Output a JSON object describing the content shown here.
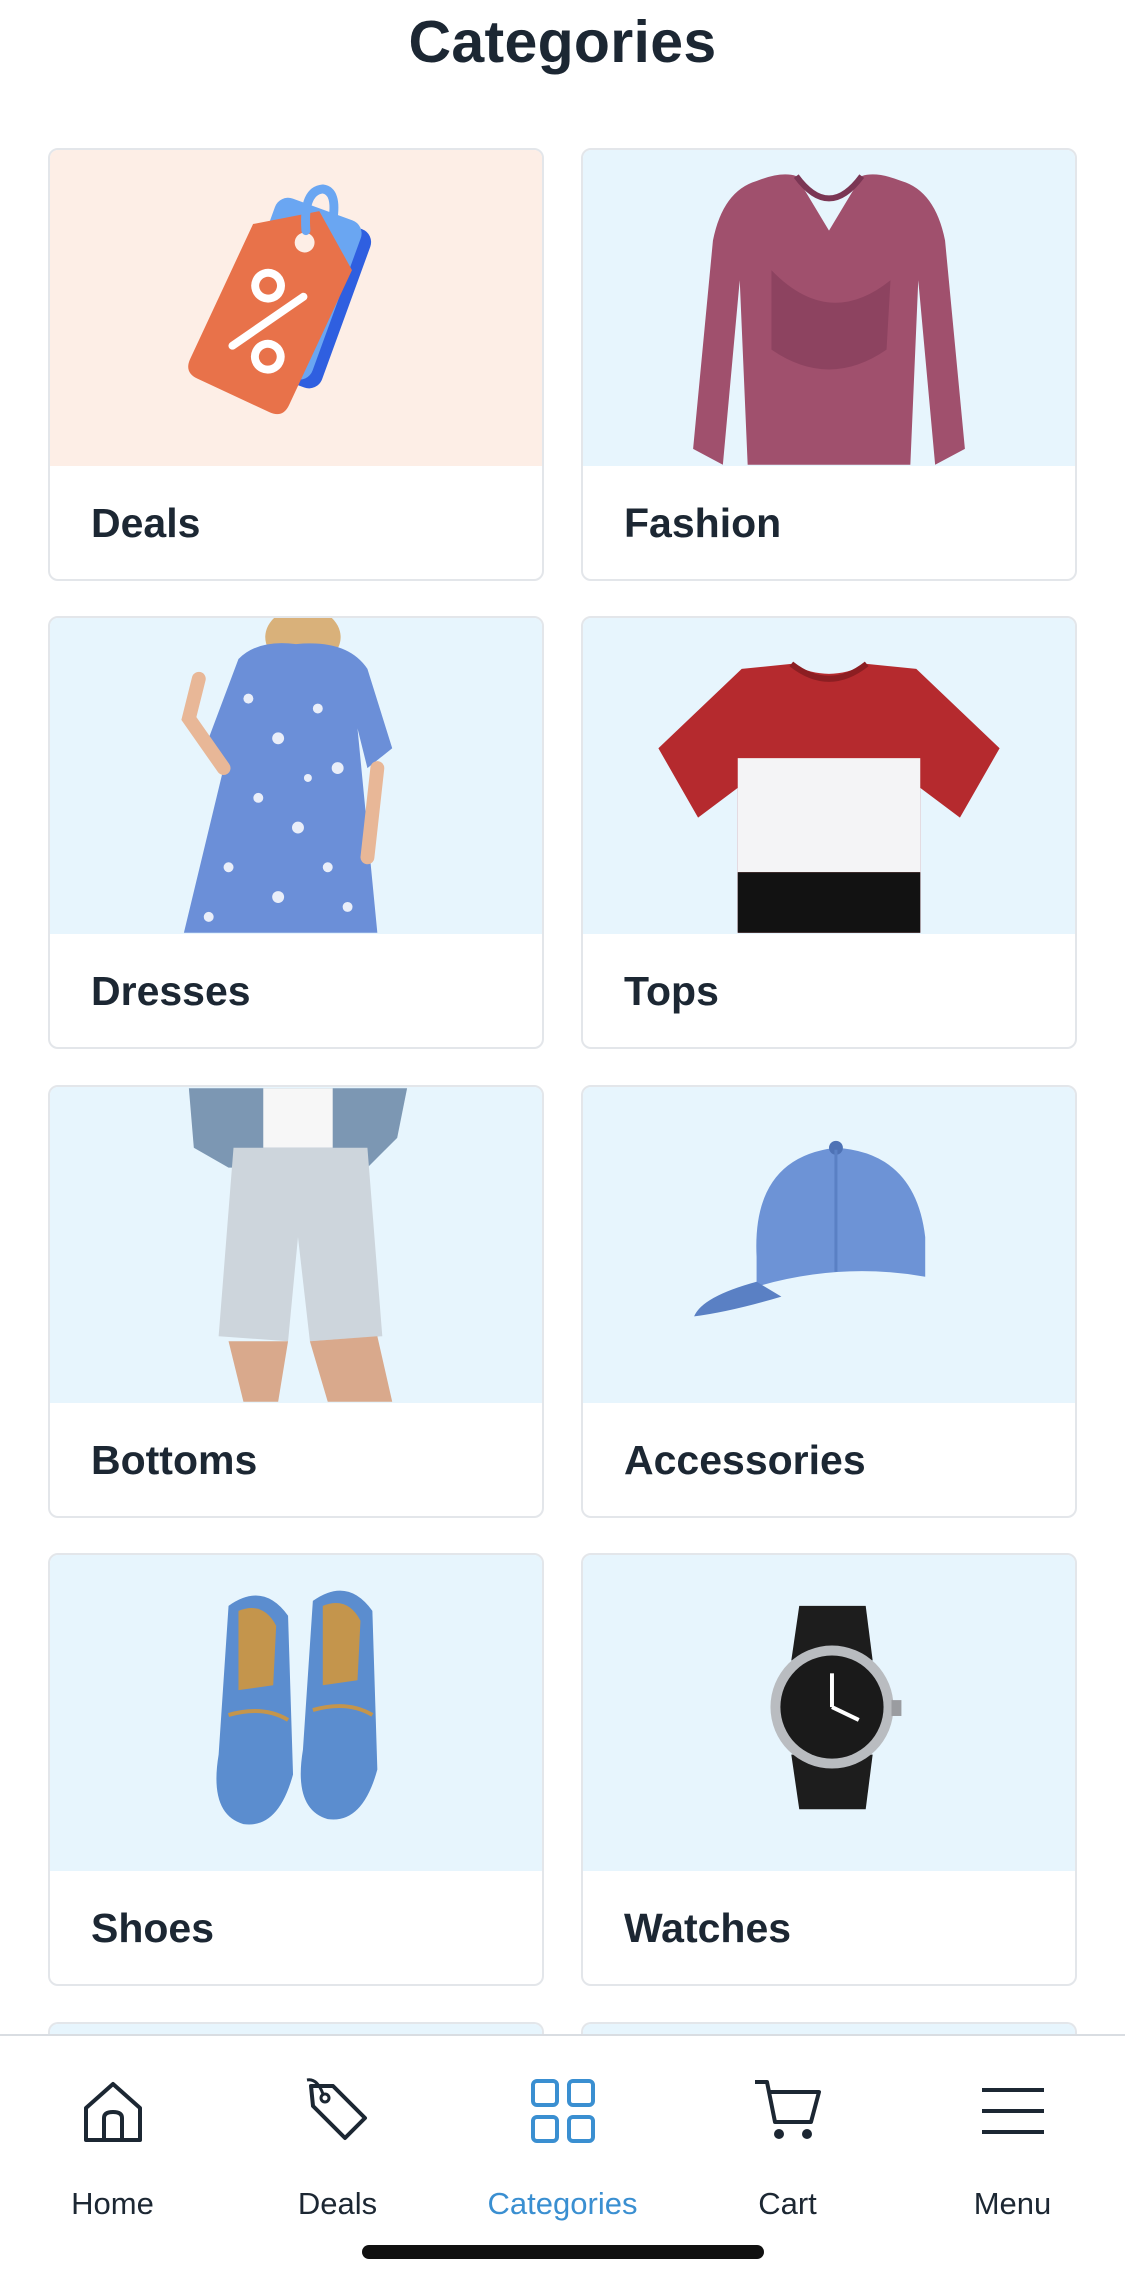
{
  "header": {
    "title": "Categories"
  },
  "categories": [
    {
      "label": "Deals",
      "image": "discount-tag-illustration"
    },
    {
      "label": "Fashion",
      "image": "mauve-knit-top-photo"
    },
    {
      "label": "Dresses",
      "image": "blue-floral-dress-photo"
    },
    {
      "label": "Tops",
      "image": "colorblock-tshirt-photo"
    },
    {
      "label": "Bottoms",
      "image": "denim-shorts-photo"
    },
    {
      "label": "Accessories",
      "image": "blue-cap-photo"
    },
    {
      "label": "Shoes",
      "image": "blue-shoes-photo"
    },
    {
      "label": "Watches",
      "image": "wristwatch-photo"
    }
  ],
  "tabbar": {
    "items": [
      {
        "label": "Home",
        "icon": "home-icon",
        "active": false
      },
      {
        "label": "Deals",
        "icon": "tag-icon",
        "active": false
      },
      {
        "label": "Categories",
        "icon": "grid-icon",
        "active": true
      },
      {
        "label": "Cart",
        "icon": "cart-icon",
        "active": false
      },
      {
        "label": "Menu",
        "icon": "hamburger-icon",
        "active": false
      }
    ]
  },
  "colors": {
    "accent": "#3a8fd1",
    "text": "#1c2733",
    "tile_bg": "#e7f5fd",
    "deals_tile_bg": "#fdeee6",
    "card_border": "#e3e6ea"
  }
}
